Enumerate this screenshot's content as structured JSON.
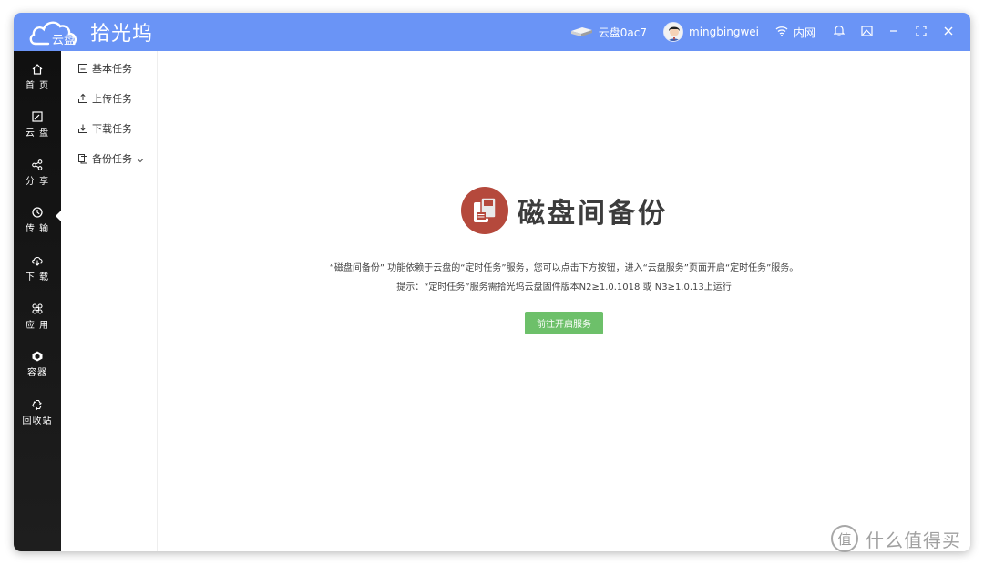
{
  "app": {
    "brand_cloud_text": "云盘",
    "brand_name": "拾光坞",
    "device_name": "云盘0ac7",
    "username": "mingbingwei",
    "network_label": "内网"
  },
  "sidebar": {
    "items": [
      {
        "label": "首 页",
        "icon": "home-icon"
      },
      {
        "label": "云 盘",
        "icon": "cloud-disk-icon"
      },
      {
        "label": "分 享",
        "icon": "share-icon"
      },
      {
        "label": "传 输",
        "icon": "transfer-icon"
      },
      {
        "label": "下 载",
        "icon": "download-icon"
      },
      {
        "label": "应 用",
        "icon": "apps-icon"
      },
      {
        "label": "容器",
        "icon": "container-icon"
      },
      {
        "label": "回收站",
        "icon": "recycle-icon"
      }
    ],
    "active_index": 3
  },
  "subnav": {
    "items": [
      {
        "label": "基本任务",
        "icon": "task-list-icon"
      },
      {
        "label": "上传任务",
        "icon": "upload-icon"
      },
      {
        "label": "下载任务",
        "icon": "download-icon"
      },
      {
        "label": "备份任务",
        "icon": "copy-icon"
      }
    ]
  },
  "main": {
    "title": "磁盘间备份",
    "desc_line1": "“磁盘间备份” 功能依赖于云盘的“定时任务”服务，您可以点击下方按钮，进入“云盘服务”页面开启“定时任务”服务。",
    "desc_line2": "提示：“定时任务”服务需拾光坞云盘固件版本N2≥1.0.1018 或 N3≥1.0.13上运行",
    "button_label": "前往开启服务"
  },
  "watermark": {
    "glyph": "值",
    "text": "什么值得买"
  },
  "colors": {
    "titlebar": "#6a94f6",
    "sidebar": "#141414",
    "primary_button": "#6dc06a",
    "logo_red": "#b5493c"
  }
}
